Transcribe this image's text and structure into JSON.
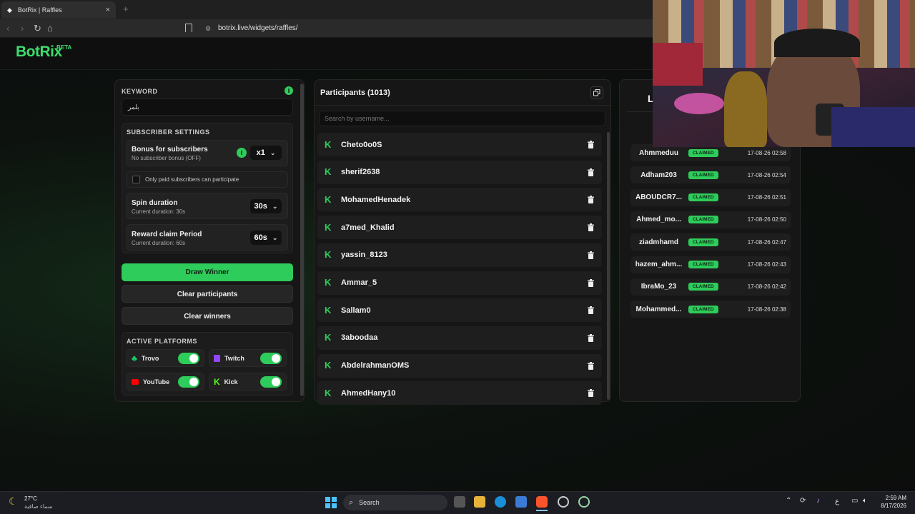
{
  "browser": {
    "tab_title": "BotRix | Raffles",
    "tab_close": "×",
    "new_tab": "+",
    "url": "botrix.live/widgets/raffles/"
  },
  "app": {
    "logo": "BotRix",
    "beta": "BETA"
  },
  "settings": {
    "keyword_label": "KEYWORD",
    "keyword_value": "بلمر",
    "subscriber_settings_label": "SUBSCRIBER SETTINGS",
    "bonus_title": "Bonus for subscribers",
    "bonus_desc": "No subscriber bonus (OFF)",
    "bonus_value": "x1",
    "paid_only_label": "Only paid subscribers can participate",
    "paid_only_checked": false,
    "spin_title": "Spin duration",
    "spin_desc": "Current duration: 30s",
    "spin_value": "30s",
    "reward_title": "Reward claim Period",
    "reward_desc": "Current duration: 60s",
    "reward_value": "60s",
    "draw_button": "Draw Winner",
    "clear_participants_button": "Clear participants",
    "clear_winners_button": "Clear winners",
    "active_platforms_label": "ACTIVE PLATFORMS",
    "platforms": [
      {
        "name": "Trovo",
        "enabled": true,
        "color": "#19d66b"
      },
      {
        "name": "Twitch",
        "enabled": true,
        "color": "#9146ff"
      },
      {
        "name": "YouTube",
        "enabled": true,
        "color": "#ff0000"
      },
      {
        "name": "Kick",
        "enabled": true,
        "color": "#53fc18"
      }
    ]
  },
  "participants": {
    "title": "Participants (1013)",
    "search_placeholder": "Search by username...",
    "list": [
      "Cheto0o0S",
      "sherif2638",
      "MohamedHenadek",
      "a7med_Khalid",
      "yassin_8123",
      "Ammar_5",
      "Sallam0",
      "3aboodaa",
      "AbdelrahmanOMS",
      "AhmedHany10"
    ]
  },
  "winners": {
    "title_partial": "L",
    "badge": "CLAIMED",
    "list": [
      {
        "name": "Ahmmeduu",
        "date": "17-08-26 02:58"
      },
      {
        "name": "Adham203",
        "date": "17-08-26 02:54"
      },
      {
        "name": "ABOUDCR7...",
        "date": "17-08-26 02:51"
      },
      {
        "name": "Ahmed_mo...",
        "date": "17-08-26 02:50"
      },
      {
        "name": "ziadmhamd",
        "date": "17-08-26 02:47"
      },
      {
        "name": "hazem_ahm...",
        "date": "17-08-26 02:43"
      },
      {
        "name": "IbraMo_23",
        "date": "17-08-26 02:42"
      },
      {
        "name": "Mohammed...",
        "date": "17-08-26 02:38"
      }
    ]
  },
  "taskbar": {
    "weather_temp": "27°C",
    "weather_desc": "سماء صافية",
    "search": "Search",
    "lang": "ع",
    "time": "2:59 AM",
    "date": "8/17/2026"
  },
  "colors": {
    "accent": "#2ecc5a",
    "background": "#0b0c0c",
    "panel": "#161616"
  }
}
